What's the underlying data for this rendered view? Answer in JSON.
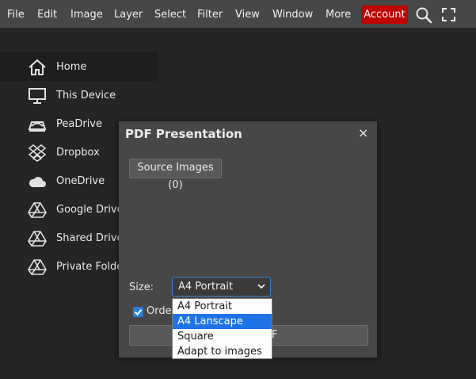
{
  "menu": {
    "items": [
      "File",
      "Edit",
      "Image",
      "Layer",
      "Select",
      "Filter",
      "View",
      "Window",
      "More"
    ],
    "account_label": "Account",
    "account_color": "#c00000"
  },
  "toolbar": {
    "search_icon": "search-icon",
    "fullscreen_icon": "fullscreen-icon"
  },
  "sidebar": {
    "items": [
      {
        "label": "Home",
        "icon": "home-icon"
      },
      {
        "label": "This Device",
        "icon": "monitor-icon"
      },
      {
        "label": "PeaDrive",
        "icon": "peadrive-icon"
      },
      {
        "label": "Dropbox",
        "icon": "dropbox-icon"
      },
      {
        "label": "OneDrive",
        "icon": "cloud-icon"
      },
      {
        "label": "Google Drive",
        "icon": "google-drive-icon"
      },
      {
        "label": "Shared Drive",
        "icon": "google-drive-icon"
      },
      {
        "label": "Private Folder",
        "icon": "google-drive-icon"
      }
    ]
  },
  "dialog": {
    "title": "PDF Presentation",
    "close_symbol": "×",
    "source_button": "Source Images (0)",
    "size_label": "Size:",
    "size_value": "A4 Portrait",
    "order_label": "Order",
    "order_checked": true,
    "create_button": "Create PDF",
    "size_options": [
      "A4 Portrait",
      "A4 Lanscape",
      "Square",
      "Adapt to images"
    ],
    "highlighted_option": "A4 Lanscape"
  },
  "colors": {
    "accent": "#1e73e6",
    "menubar": "#474747",
    "background": "#252525"
  }
}
